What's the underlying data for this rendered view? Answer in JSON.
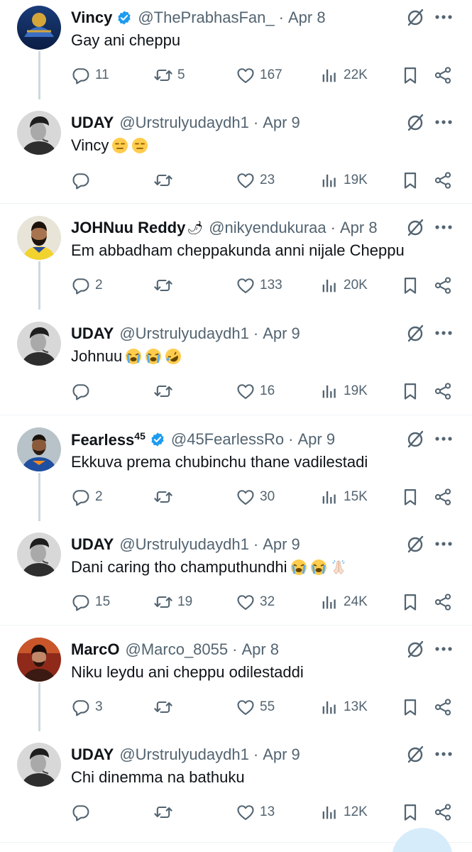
{
  "colors": {
    "muted": "#536471",
    "text": "#0f1419",
    "verified": "#1d9bf0",
    "thread_line": "#cfd9de"
  },
  "tweets": [
    {
      "name": "Vincy",
      "verified": true,
      "handle": "@ThePrabhasFan_",
      "date": "Apr 8",
      "text": "Gay ani cheppu",
      "emojis": [],
      "replies": "11",
      "reposts": "5",
      "likes": "167",
      "views": "22K",
      "avatar": "cricket-team-logo"
    },
    {
      "name": "UDAY",
      "verified": false,
      "handle": "@Urstrulyudaydh1",
      "date": "Apr 9",
      "text": "Vincy",
      "emojis": [
        "expressionless",
        "expressionless"
      ],
      "replies": "",
      "reposts": "",
      "likes": "23",
      "views": "19K",
      "avatar": "man-portrait"
    },
    {
      "name": "JOHNuu Reddy",
      "verified": false,
      "name_emoji": "🌶",
      "handle": "@nikyendukuraa",
      "date": "Apr 8",
      "text": "Em abbadham cheppakunda anni nijale Cheppu",
      "emojis": [],
      "replies": "2",
      "reposts": "",
      "likes": "133",
      "views": "20K",
      "avatar": "bearded-man-yellow-jersey"
    },
    {
      "name": "UDAY",
      "verified": false,
      "handle": "@Urstrulyudaydh1",
      "date": "Apr 9",
      "text": "Johnuu",
      "emojis": [
        "crying",
        "crying",
        "rofl"
      ],
      "replies": "",
      "reposts": "",
      "likes": "16",
      "views": "19K",
      "avatar": "man-portrait"
    },
    {
      "name": "Fearless",
      "name_sup": "45",
      "verified": true,
      "handle": "@45FearlessRo",
      "date": "Apr 9",
      "text": "Ekkuva prema chubinchu thane vadilestadi",
      "emojis": [],
      "replies": "2",
      "reposts": "",
      "likes": "30",
      "views": "15K",
      "avatar": "cricketer-blue-jersey"
    },
    {
      "name": "UDAY",
      "verified": false,
      "handle": "@Urstrulyudaydh1",
      "date": "Apr 9",
      "text": "Dani caring tho champuthundhi",
      "emojis": [
        "crying",
        "crying",
        "folded-hands"
      ],
      "replies": "15",
      "reposts": "19",
      "likes": "32",
      "views": "24K",
      "avatar": "man-portrait"
    },
    {
      "name": "MarcO",
      "verified": false,
      "handle": "@Marco_8055",
      "date": "Apr 8",
      "text": "Niku leydu ani cheppu odilestaddi",
      "emojis": [],
      "replies": "3",
      "reposts": "",
      "likes": "55",
      "views": "13K",
      "avatar": "man-red-portrait"
    },
    {
      "name": "UDAY",
      "verified": false,
      "handle": "@Urstrulyudaydh1",
      "date": "Apr 9",
      "text": "Chi dinemma na bathuku",
      "emojis": [],
      "replies": "",
      "reposts": "",
      "likes": "13",
      "views": "12K",
      "avatar": "man-portrait"
    }
  ]
}
